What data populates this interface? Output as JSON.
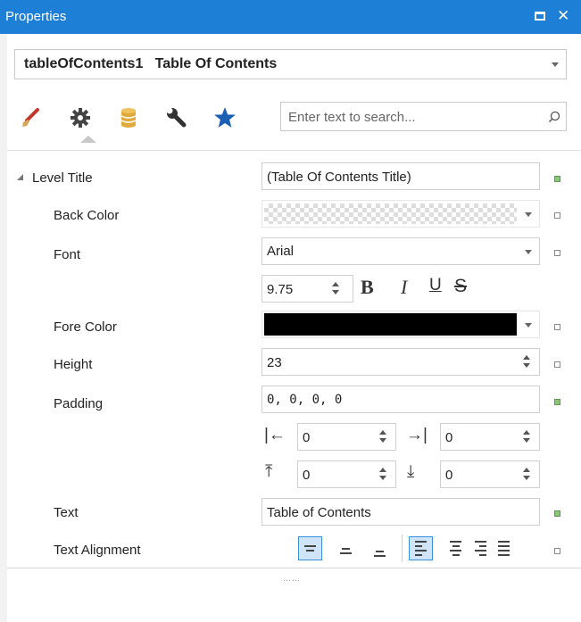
{
  "window": {
    "title": "Properties"
  },
  "selector": {
    "value": "tableOfContents1   Table Of Contents"
  },
  "tabs": [
    {
      "name": "brush-icon",
      "label": "Appearance"
    },
    {
      "name": "gear-icon",
      "label": "Behavior"
    },
    {
      "name": "database-icon",
      "label": "Data"
    },
    {
      "name": "wrench-icon",
      "label": "Design"
    },
    {
      "name": "star-icon",
      "label": "Favorites"
    }
  ],
  "search": {
    "placeholder": "Enter text to search..."
  },
  "properties": {
    "level_title": {
      "label": "Level Title",
      "value": "(Table Of Contents Title)"
    },
    "back_color": {
      "label": "Back Color"
    },
    "font": {
      "label": "Font",
      "value": "Arial",
      "size": "9.75",
      "bold": "B",
      "italic": "I",
      "underline": "U",
      "strikeout": "S"
    },
    "fore_color": {
      "label": "Fore Color",
      "color": "#000000"
    },
    "height": {
      "label": "Height",
      "value": "23"
    },
    "padding": {
      "label": "Padding",
      "value": "0, 0, 0, 0",
      "left": "0",
      "right": "0",
      "top": "0",
      "bottom": "0"
    },
    "text": {
      "label": "Text",
      "value": "Table of Contents"
    },
    "text_alignment": {
      "label": "Text Alignment"
    }
  },
  "colors": {
    "accent": "#1e7fd6",
    "modified_marker": "#8cc47a",
    "selected_button": "#cfe4f7"
  }
}
